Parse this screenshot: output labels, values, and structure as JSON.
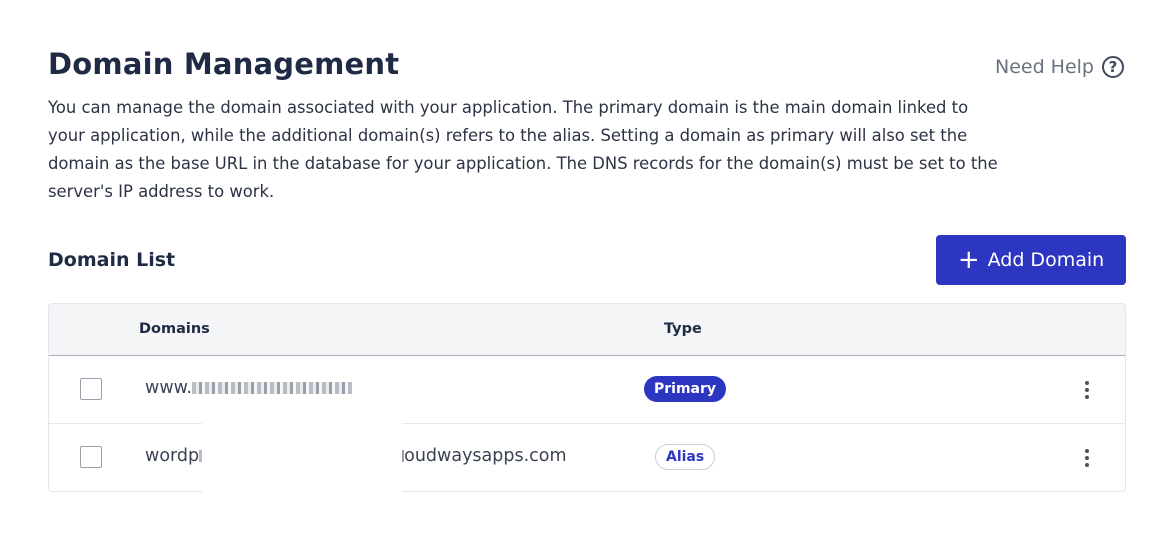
{
  "header": {
    "title": "Domain Management",
    "help_label": "Need Help",
    "help_icon": "question-circle-icon"
  },
  "description": "You can manage the domain associated with your application. The primary domain is the main domain linked to your application, while the additional domain(s) refers to the alias. Setting a domain as primary will also set the domain as the base URL in the database for your application. The DNS records for the domain(s) must be set to the server's IP address to work.",
  "domain_list": {
    "title": "Domain List",
    "add_button_label": "Add Domain",
    "add_button_icon": "plus-icon",
    "columns": {
      "domains": "Domains",
      "type": "Type"
    },
    "rows": [
      {
        "domain_prefix": "www.",
        "domain_suffix": "",
        "type": "Primary"
      },
      {
        "domain_prefix": "wordp",
        "domain_suffix": "oudwaysapps.com",
        "type": "Alias"
      }
    ]
  },
  "colors": {
    "accent": "#2d36c1",
    "text": "#1f2a44",
    "muted": "#6b7280"
  }
}
